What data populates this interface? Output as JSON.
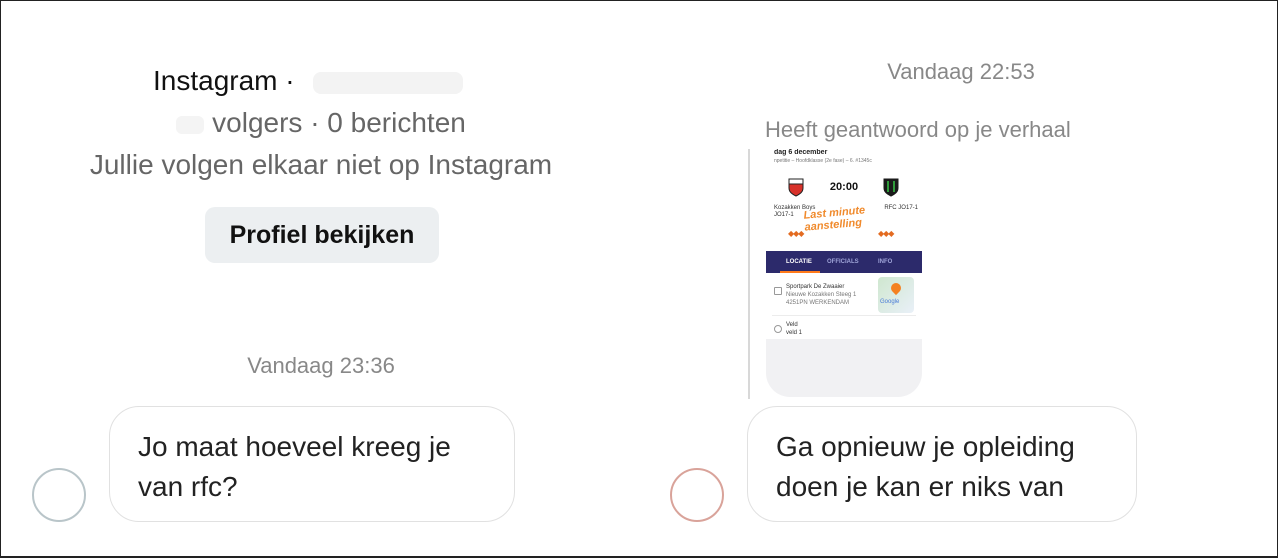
{
  "left_panel": {
    "profile": {
      "platform": "Instagram ·",
      "stats": "volgers · 0 berichten",
      "follow_status": "Jullie volgen elkaar niet op Instagram",
      "view_profile_button": "Profiel bekijken"
    },
    "timestamp": "Vandaag 23:36",
    "message": {
      "line1": "Jo maat hoeveel kreeg je",
      "line2": "van rfc?"
    }
  },
  "right_panel": {
    "timestamp": "Vandaag 22:53",
    "reply_label": "Heeft geantwoord op je verhaal",
    "story": {
      "date": "dag 6 december",
      "competition": "npetitie – Hoofdklasse (2e fase) – 6. #1345c",
      "time": "20:00",
      "home_team": "Kozakken Boys",
      "home_team_sub": "JO17-1",
      "away_team": "RFC JO17-1",
      "promo_line1": "Last minute",
      "promo_line2": "aanstelling",
      "dots_left": "◆◆◆",
      "dots_right": "◆◆◆",
      "tabs": [
        "LOCATIE",
        "OFFICIALS",
        "INFO"
      ],
      "location_name": "Sportpark De Zwaaier",
      "location_street": "Nieuwe Kozakken Steeg 1",
      "location_city": "4251PN WERKENDAM",
      "map_label": "Google",
      "field_label": "Veld",
      "field_value": "veld 1"
    },
    "message": {
      "line1": "Ga opnieuw je opleiding",
      "line2": "doen je kan er niks van"
    }
  },
  "colors": {
    "bubble_border": "#e1e1e1",
    "timestamp_text": "#888888",
    "button_bg": "#eceff1",
    "story_tab_bar": "#2c2a6b",
    "story_accent": "#f08a2c"
  }
}
